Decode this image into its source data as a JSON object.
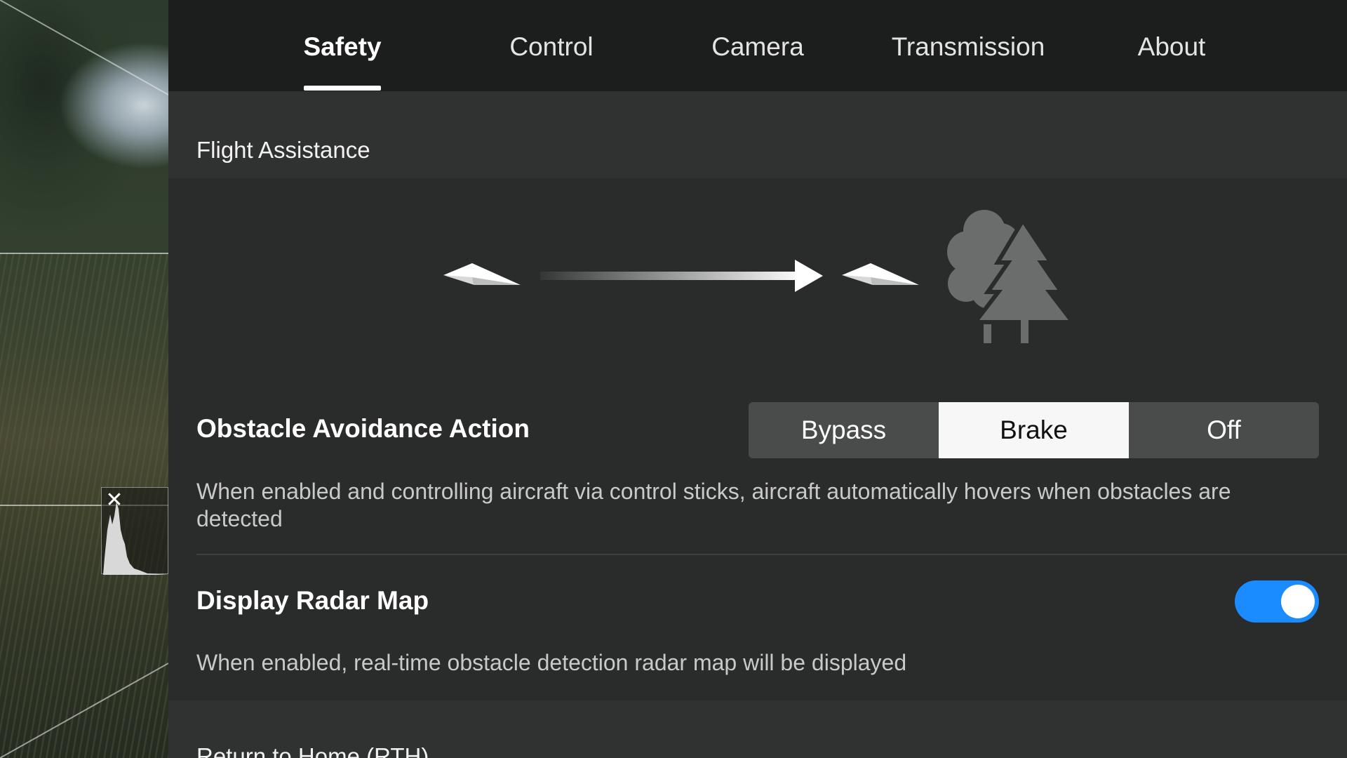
{
  "tabs": [
    {
      "label": "Safety",
      "active": true
    },
    {
      "label": "Control",
      "active": false
    },
    {
      "label": "Camera",
      "active": false
    },
    {
      "label": "Transmission",
      "active": false
    },
    {
      "label": "About",
      "active": false
    }
  ],
  "flight_assistance": {
    "header": "Flight Assistance",
    "illustration_icons": [
      "paper-plane-icon",
      "arrow-right-icon",
      "paper-plane-icon",
      "trees-icon"
    ]
  },
  "obstacle_avoidance": {
    "title": "Obstacle Avoidance Action",
    "options": [
      "Bypass",
      "Brake",
      "Off"
    ],
    "selected": "Brake",
    "description": "When enabled and controlling aircraft via control sticks, aircraft automatically hovers when obstacles are detected"
  },
  "radar_map": {
    "title": "Display Radar Map",
    "enabled": true,
    "description": "When enabled, real-time obstacle detection radar map will be displayed"
  },
  "rth": {
    "header": "Return to Home (RTH)"
  },
  "histogram": {
    "close_icon": "close-icon"
  },
  "colors": {
    "accent": "#1a8cff",
    "panel_bg": "#2a2b2b",
    "tabbar_bg": "#1c1d1d",
    "section_bg": "#303131"
  }
}
